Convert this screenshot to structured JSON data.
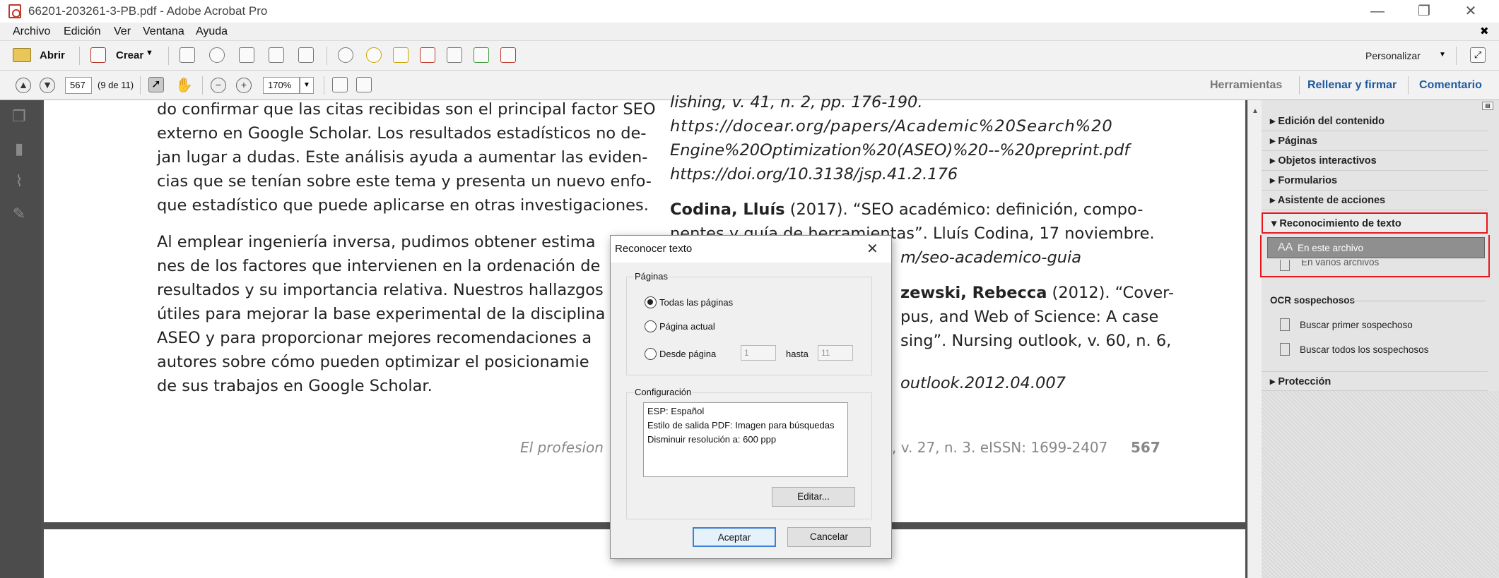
{
  "window": {
    "title": "66201-203261-3-PB.pdf - Adobe Acrobat Pro",
    "minimize": "—",
    "maximize": "❐",
    "close": "✕"
  },
  "menu": [
    "Archivo",
    "Edición",
    "Ver",
    "Ventana",
    "Ayuda"
  ],
  "menu_close": "✖",
  "toolbar": {
    "open_label": "Abrir",
    "create_label": "Crear",
    "customize_label": "Personalizar"
  },
  "nav": {
    "page_value": "567",
    "page_of": "(9 de 11)",
    "zoom_value": "170%"
  },
  "tabs": {
    "tools": "Herramientas",
    "fill_sign": "Rellenar y firmar",
    "comment": "Comentario"
  },
  "doc": {
    "left_col": [
      "do confirmar que las citas recibidas son el principal factor SEO",
      "externo en Google Scholar. Los resultados estadísticos no de-",
      "jan lugar a dudas. Este análisis ayuda a aumentar las eviden-",
      "cias que se tenían sobre este tema y presenta un nuevo enfo-",
      "que estadístico que puede aplicarse en otras investigaciones."
    ],
    "left_col2": [
      "Al emplear ingeniería inversa, pudimos obtener estima",
      "nes de los factores que intervienen en la ordenación de",
      "resultados y su importancia relativa. Nuestros hallazgos",
      "útiles para mejorar la base experimental de la disciplina",
      "ASEO y para proporcionar mejores recomendaciones a",
      "autores sobre cómo pueden optimizar el posicionamie",
      "de sus trabajos en Google Scholar."
    ],
    "right_col": [
      "lishing, v. 41, n. 2, pp. 176-190.",
      "https://docear.org/papers/Academic%20Search%20",
      "Engine%20Optimization%20(ASEO)%20--%20preprint.pdf",
      "https://doi.org/10.3138/jsp.41.2.176"
    ],
    "ref2_author": "Codina, Lluís",
    "ref2_line1": " (2017). “SEO académico: definición, compo-",
    "ref2_line2": "nentes y guía de herramientas”. Lluís Codina, 17 noviembre.",
    "ref2_line3": "m/seo-academico-guia",
    "ref3_line1_bold": "zewski, Rebecca",
    "ref3_line1": " (2012). “Cover-",
    "ref3_line2": "pus, and Web of Science: A case",
    "ref3_line3": "sing”. Nursing outlook, v. 60, n. 6,",
    "ref3_line4": "outlook.2012.04.007",
    "footer_left": "El profesion",
    "footer_right": ", v. 27, n. 3. eISSN: 1699-2407",
    "footer_page": "567"
  },
  "panel": {
    "sections": [
      "Edición del contenido",
      "Páginas",
      "Objetos interactivos",
      "Formularios",
      "Asistente de acciones"
    ],
    "expanded": "Reconocimiento de texto",
    "items": [
      "En este archivo",
      "En varios archivos"
    ],
    "ocr_header": "OCR sospechosos",
    "ocr_items": [
      "Buscar primer sospechoso",
      "Buscar todos los sospechosos"
    ],
    "protection": "Protección",
    "highlight_color": "#e8161b"
  },
  "dialog": {
    "title": "Reconocer texto",
    "pages_group": "Páginas",
    "opt_all": "Todas las páginas",
    "opt_current": "Página actual",
    "opt_from": "Desde página",
    "from_value": "1",
    "to_label": "hasta",
    "to_value": "11",
    "config_group": "Configuración",
    "config_lines": [
      "ESP: Español",
      "Estilo de salida PDF: Imagen para búsquedas",
      "Disminuir resolución a: 600 ppp"
    ],
    "edit_btn": "Editar...",
    "ok_btn": "Aceptar",
    "cancel_btn": "Cancelar"
  }
}
